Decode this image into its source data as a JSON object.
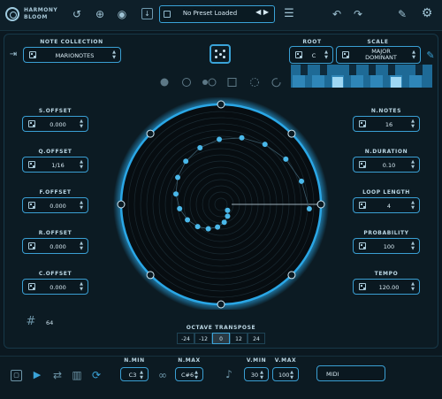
{
  "app": {
    "name_line1": "HARMONY",
    "name_line2": "BLOOM"
  },
  "toolbar": {
    "preset_name": "No Preset Loaded",
    "icons": [
      "reset-icon",
      "add-icon",
      "eye-icon",
      "save-icon",
      "prev-arrow-icon",
      "next-arrow-icon",
      "menu-icon",
      "undo-icon",
      "redo-icon",
      "brush-icon",
      "settings-icon"
    ]
  },
  "note_collection": {
    "label": "NOTE COLLECTION",
    "value": "MARIONOTES"
  },
  "root": {
    "label": "ROOT",
    "value": "C"
  },
  "scale": {
    "label": "SCALE",
    "value_line1": "MAJOR",
    "value_line2": "DOMINANT"
  },
  "left_params": [
    {
      "label": "S.OFFSET",
      "value": "0.000"
    },
    {
      "label": "Q.OFFSET",
      "value": "1/16"
    },
    {
      "label": "F.OFFSET",
      "value": "0.000"
    },
    {
      "label": "R.OFFSET",
      "value": "0.000"
    },
    {
      "label": "C.OFFSET",
      "value": "0.000"
    }
  ],
  "right_params": [
    {
      "label": "N.NOTES",
      "value": "16"
    },
    {
      "label": "N.DURATION",
      "value": "0.10"
    },
    {
      "label": "LOOP LENGTH",
      "value": "4"
    },
    {
      "label": "PROBABILITY",
      "value": "100"
    },
    {
      "label": "TEMPO",
      "value": "120.00"
    }
  ],
  "grid": {
    "value": "64"
  },
  "octave": {
    "label": "OCTAVE TRANSPOSE",
    "options": [
      "-24",
      "-12",
      "0",
      "12",
      "24"
    ],
    "selected": "0"
  },
  "bottom": {
    "n_min": {
      "label": "N.MIN",
      "value": "C3"
    },
    "n_max": {
      "label": "N.MAX",
      "value": "C#6"
    },
    "v_min": {
      "label": "V.MIN",
      "value": "30"
    },
    "v_max": {
      "label": "V.MAX",
      "value": "100"
    },
    "midi_button": "MIDI"
  },
  "colors": {
    "accent": "#3aa3d8",
    "background": "#0b1820",
    "circle_glow": "#2aa7e6",
    "note_dot": "#4ab8ea"
  }
}
